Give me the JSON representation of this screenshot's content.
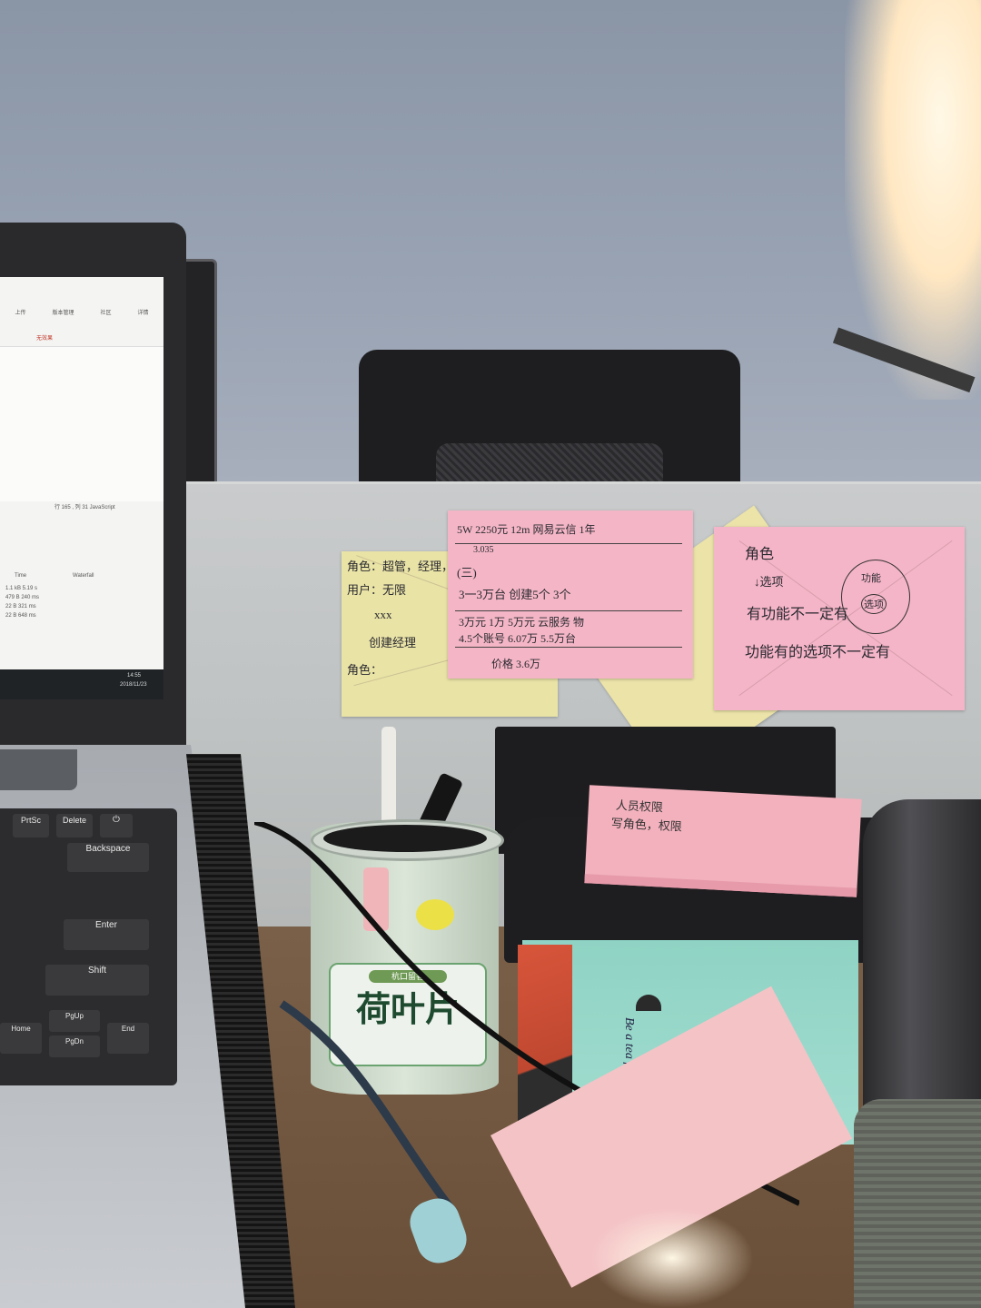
{
  "laptop": {
    "menu_items": [
      "上传",
      "版本管理",
      "社区",
      "详情"
    ],
    "toolbar_text": "无效果",
    "status_row": "行 165 , 列 31   JavaScript",
    "table_header_time": "Time",
    "table_header_waterfall": "Waterfall",
    "table_rows": [
      "1.1 kB  5.19 s",
      "479 B  240 ms",
      "22 B  321 ms",
      "22 B  648 ms"
    ],
    "taskbar_time": "14:55",
    "taskbar_date": "2018/11/23",
    "keys": [
      "PrtSc",
      "Delete",
      "Backspace",
      "Enter",
      "Shift",
      "PgUp",
      "PgDn",
      "End",
      "Home"
    ]
  },
  "notes": {
    "yellow_left": [
      "角色：超管，经理，员工(",
      "用户：无限",
      "xxx",
      "创建经理",
      "角色："
    ],
    "pink_center": [
      "5W  2250元 12m  网易云信  1年",
      "3.035",
      "(三)",
      "3一3万台   创建5个  3个",
      "3万元  1万  5万元  云服务 物",
      "4.5个账号  6.07万  5.5万台",
      "价格 3.6万"
    ],
    "pink_right": [
      "角色",
      "↓选项",
      "有功能不一定有",
      "功能有的选项不一定有",
      "功能",
      "选项"
    ],
    "pink_stack": [
      "人员权限",
      "写角色，权限"
    ]
  },
  "cup": {
    "brand": "杭口留香",
    "title": "荷叶片"
  },
  "tea_box": {
    "brand": "Be a tea fan."
  }
}
